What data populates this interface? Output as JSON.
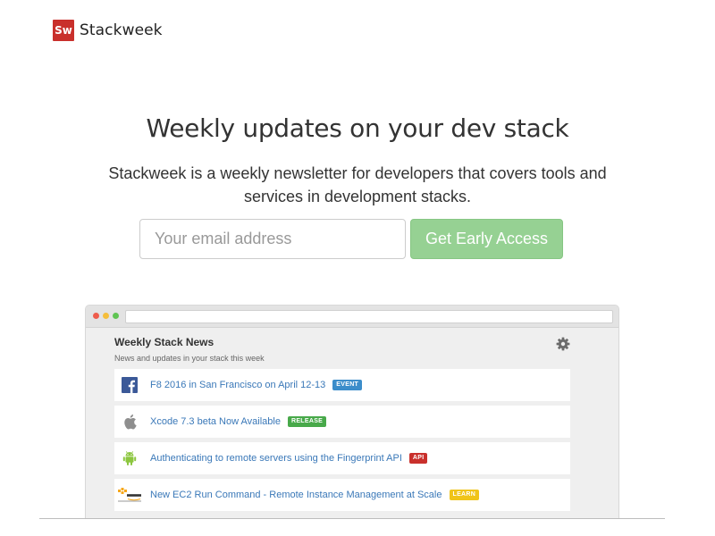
{
  "brand": {
    "mark": "Sw",
    "name": "Stackweek",
    "color": "#c9302c"
  },
  "hero": {
    "title": "Weekly updates on your dev stack",
    "subtitle": "Stackweek is a weekly newsletter for developers that covers tools and services in development stacks."
  },
  "signup": {
    "email_placeholder": "Your email address",
    "email_value": "",
    "button_label": "Get Early Access",
    "button_color": "#96d193"
  },
  "preview": {
    "panel_title": "Weekly Stack News",
    "panel_subtitle": "News and updates in your stack this week",
    "items": [
      {
        "icon": "facebook-icon",
        "title": "F8 2016 in San Francisco on April 12-13",
        "tag": "EVENT",
        "tag_color": "#3c8dca"
      },
      {
        "icon": "apple-icon",
        "title": "Xcode 7.3 beta Now Available",
        "tag": "RELEASE",
        "tag_color": "#48a94a"
      },
      {
        "icon": "android-icon",
        "title": "Authenticating to remote servers using the Fingerprint API",
        "tag": "API",
        "tag_color": "#c9302c"
      },
      {
        "icon": "amazon-web-services-icon",
        "title": "New EC2 Run Command - Remote Instance Management at Scale",
        "tag": "LEARN",
        "tag_color": "#f0c419"
      }
    ]
  }
}
